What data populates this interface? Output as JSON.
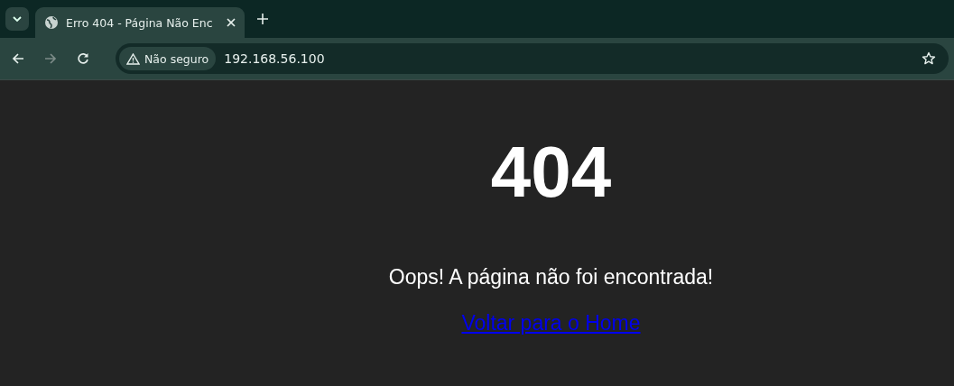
{
  "browser": {
    "tab": {
      "title": "Erro 404 - Página Não Enc",
      "selected": true
    },
    "nav_buttons": [
      {
        "kind": "back",
        "disabled": false
      },
      {
        "kind": "forward",
        "disabled": true
      },
      {
        "kind": "reload",
        "disabled": false
      }
    ],
    "security_chip": "Não seguro",
    "address": "192.168.56.100"
  },
  "page": {
    "heading": "404",
    "message": "Oops! A página não foi encontrada!",
    "link": "Voltar para o Home"
  }
}
